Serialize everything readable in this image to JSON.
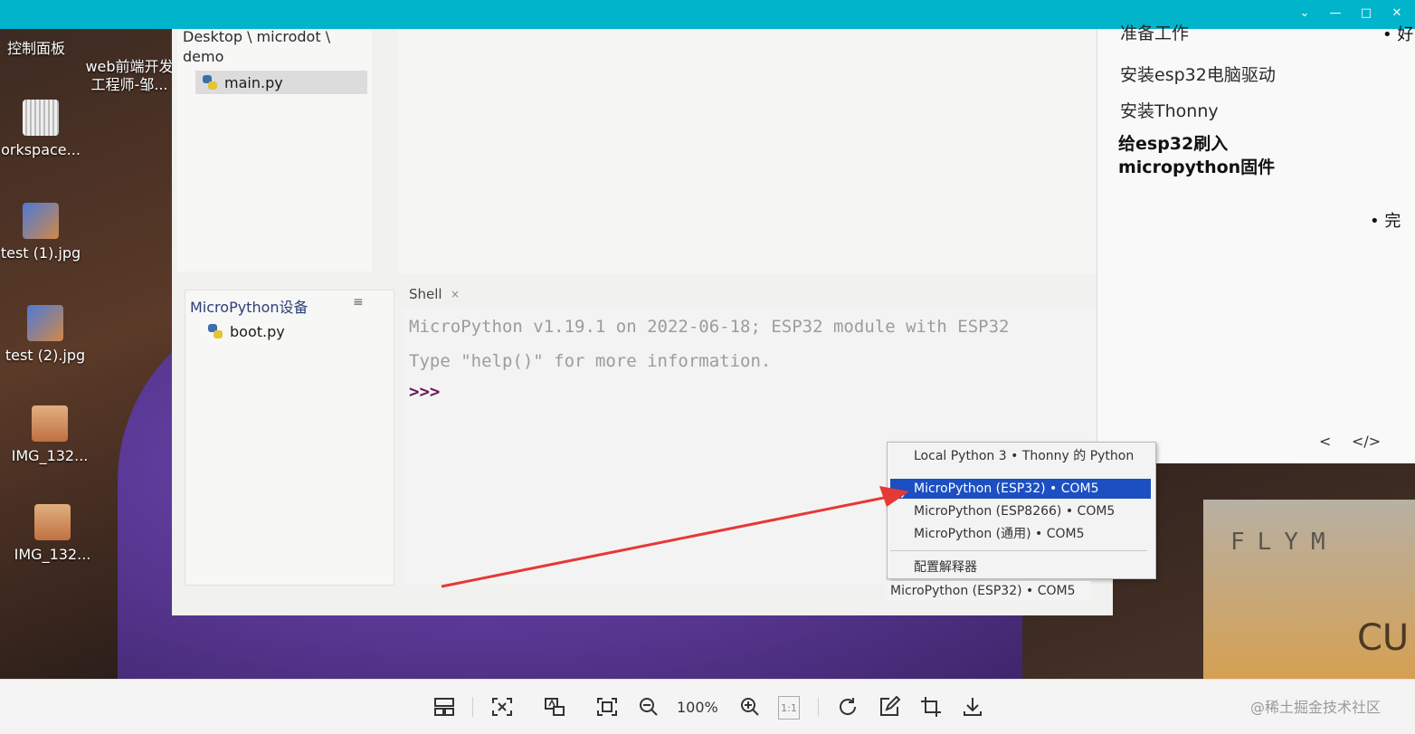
{
  "viewer": {
    "window_controls": [
      "chevron-down",
      "minimize",
      "maximize",
      "close"
    ],
    "zoom_level": "100%",
    "one_to_one_label": "1:1",
    "watermark": "@稀土掘金技术社区",
    "accent_color": "#00b4cc"
  },
  "desktop_icons": [
    {
      "label": "控制面板"
    },
    {
      "label": "web前端开发\n工程师-邹..."
    },
    {
      "label": "orkspace..."
    },
    {
      "label": "test (1).jpg"
    },
    {
      "label": "test (2).jpg"
    },
    {
      "label": "IMG_132..."
    },
    {
      "label": "IMG_132..."
    }
  ],
  "thonny": {
    "breadcrumb": "Desktop \\ microdot \\ demo",
    "files": [
      {
        "name": "main.py"
      }
    ],
    "device_panel_title": "MicroPython设备",
    "device_panel_menu": "≡",
    "device_files": [
      {
        "name": "boot.py"
      }
    ],
    "shell_tab": "Shell",
    "shell_tab_close": "×",
    "shell_lines": [
      "MicroPython v1.19.1 on 2022-06-18; ESP32 module with ESP32",
      "Type \"help()\" for more information."
    ],
    "shell_prompt": ">>>",
    "interpreter_menu": [
      {
        "label": "Local Python 3  •  Thonny 的 Python",
        "selected": false
      },
      {
        "label": "MicroPython (ESP32)  •  COM5",
        "selected": true
      },
      {
        "label": "MicroPython (ESP8266)  •  COM5",
        "selected": false
      },
      {
        "label": "MicroPython (通用)  •  COM5",
        "selected": false
      }
    ],
    "configure_interpreter": "配置解释器",
    "status_interpreter": "MicroPython (ESP32)  •  COM5",
    "selected_color": "#1b4fc2"
  },
  "document": {
    "lines": [
      "准备工作",
      "安装esp32电脑驱动",
      "安装Thonny"
    ],
    "bold_heading": "给esp32刷入\nmicropython固件",
    "bullet_1": "好",
    "bullet_2": "完",
    "nav_prev": "<",
    "nav_code": "</>"
  },
  "photo": {
    "plate_text": "FLYM",
    "plate_text2": "CU"
  },
  "arrow_color": "#e53935"
}
